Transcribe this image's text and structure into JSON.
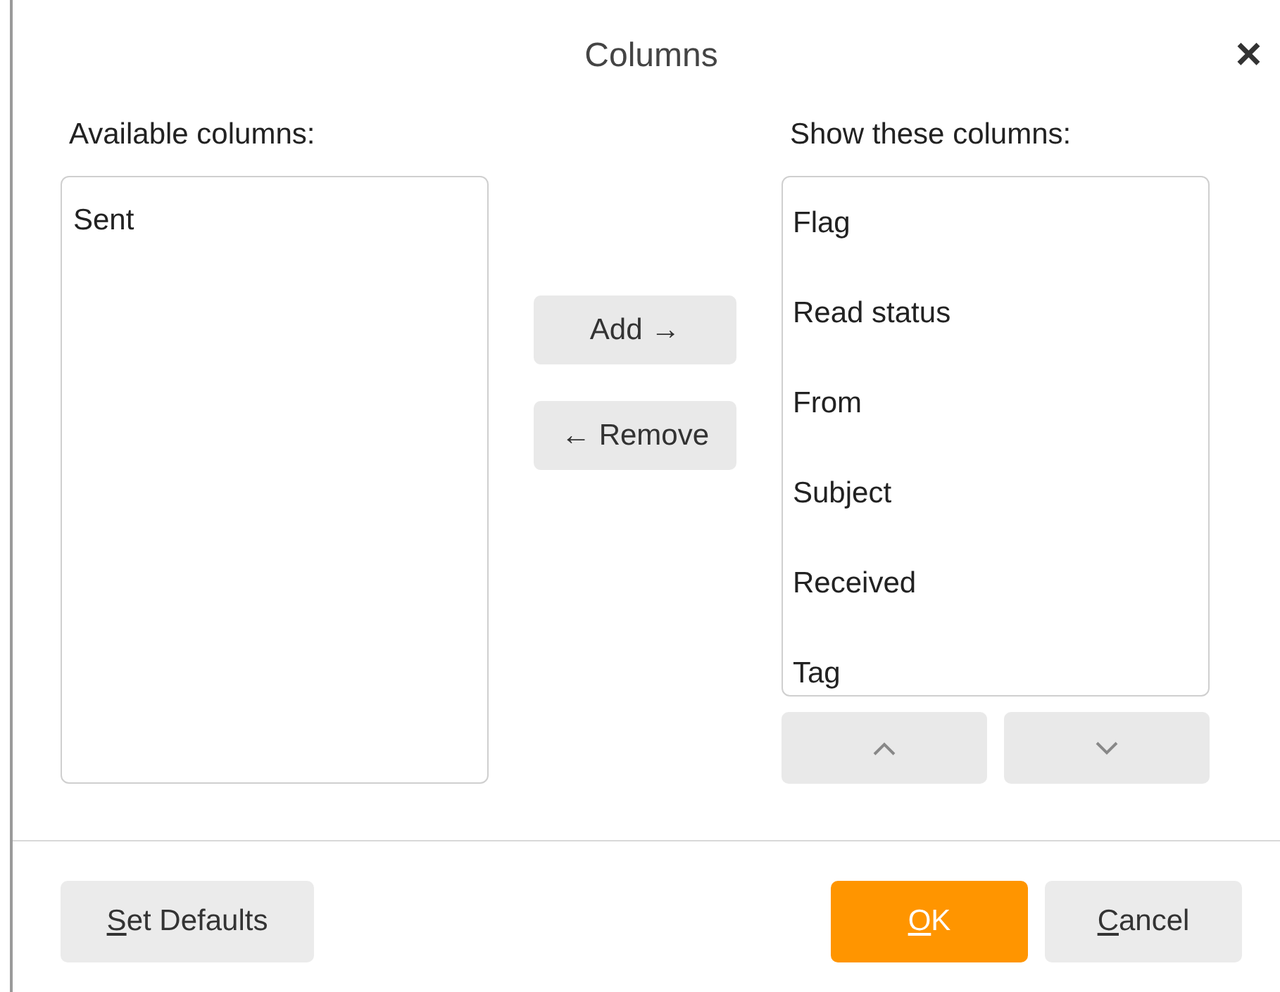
{
  "window": {
    "title": "Columns",
    "close": "×"
  },
  "available": {
    "label": "Available columns:",
    "items": [
      {
        "label": "Sent"
      }
    ]
  },
  "move_buttons": [
    "Add →",
    "← Remove"
  ],
  "shown": {
    "label": "Show these columns:",
    "items": [
      {
        "label": "Flag"
      },
      {
        "label": "Read status"
      },
      {
        "label": "From"
      },
      {
        "label": "Subject"
      },
      {
        "label": "Received"
      },
      {
        "label": "Tag"
      }
    ]
  },
  "footer": [
    {
      "label": "Set Defaults",
      "kind": "plain",
      "mnemonic": true
    },
    {
      "label": "OK",
      "kind": "primary",
      "mnemonic": true
    },
    {
      "label": "Cancel",
      "kind": "plain",
      "mnemonic": true
    }
  ]
}
